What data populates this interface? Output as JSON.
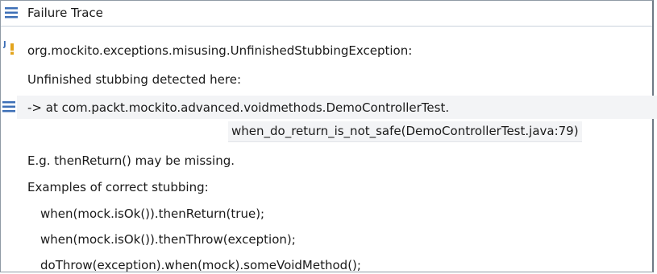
{
  "header": {
    "title": "Failure Trace",
    "icon": "stack-trace-icon"
  },
  "trace": {
    "exception": "org.mockito.exceptions.misusing.UnfinishedStubbingException:",
    "detected": "Unfinished stubbing detected here:",
    "stack_frame": "-> at com.packt.mockito.advanced.voidmethods.DemoControllerTest.",
    "stack_frame_cont": "when_do_return_is_not_safe(DemoControllerTest.java:79)",
    "hint": "E.g. thenReturn() may be missing.",
    "examples_title": "Examples of correct stubbing:",
    "examples": [
      "when(mock.isOk()).thenReturn(true);",
      "when(mock.isOk()).thenThrow(exception);",
      "doThrow(exception).when(mock).someVoidMethod();"
    ]
  },
  "colors": {
    "icon_blue": "#3d6fb6",
    "junit_orange": "#e3a41c",
    "highlight": "#f3f4f6"
  }
}
